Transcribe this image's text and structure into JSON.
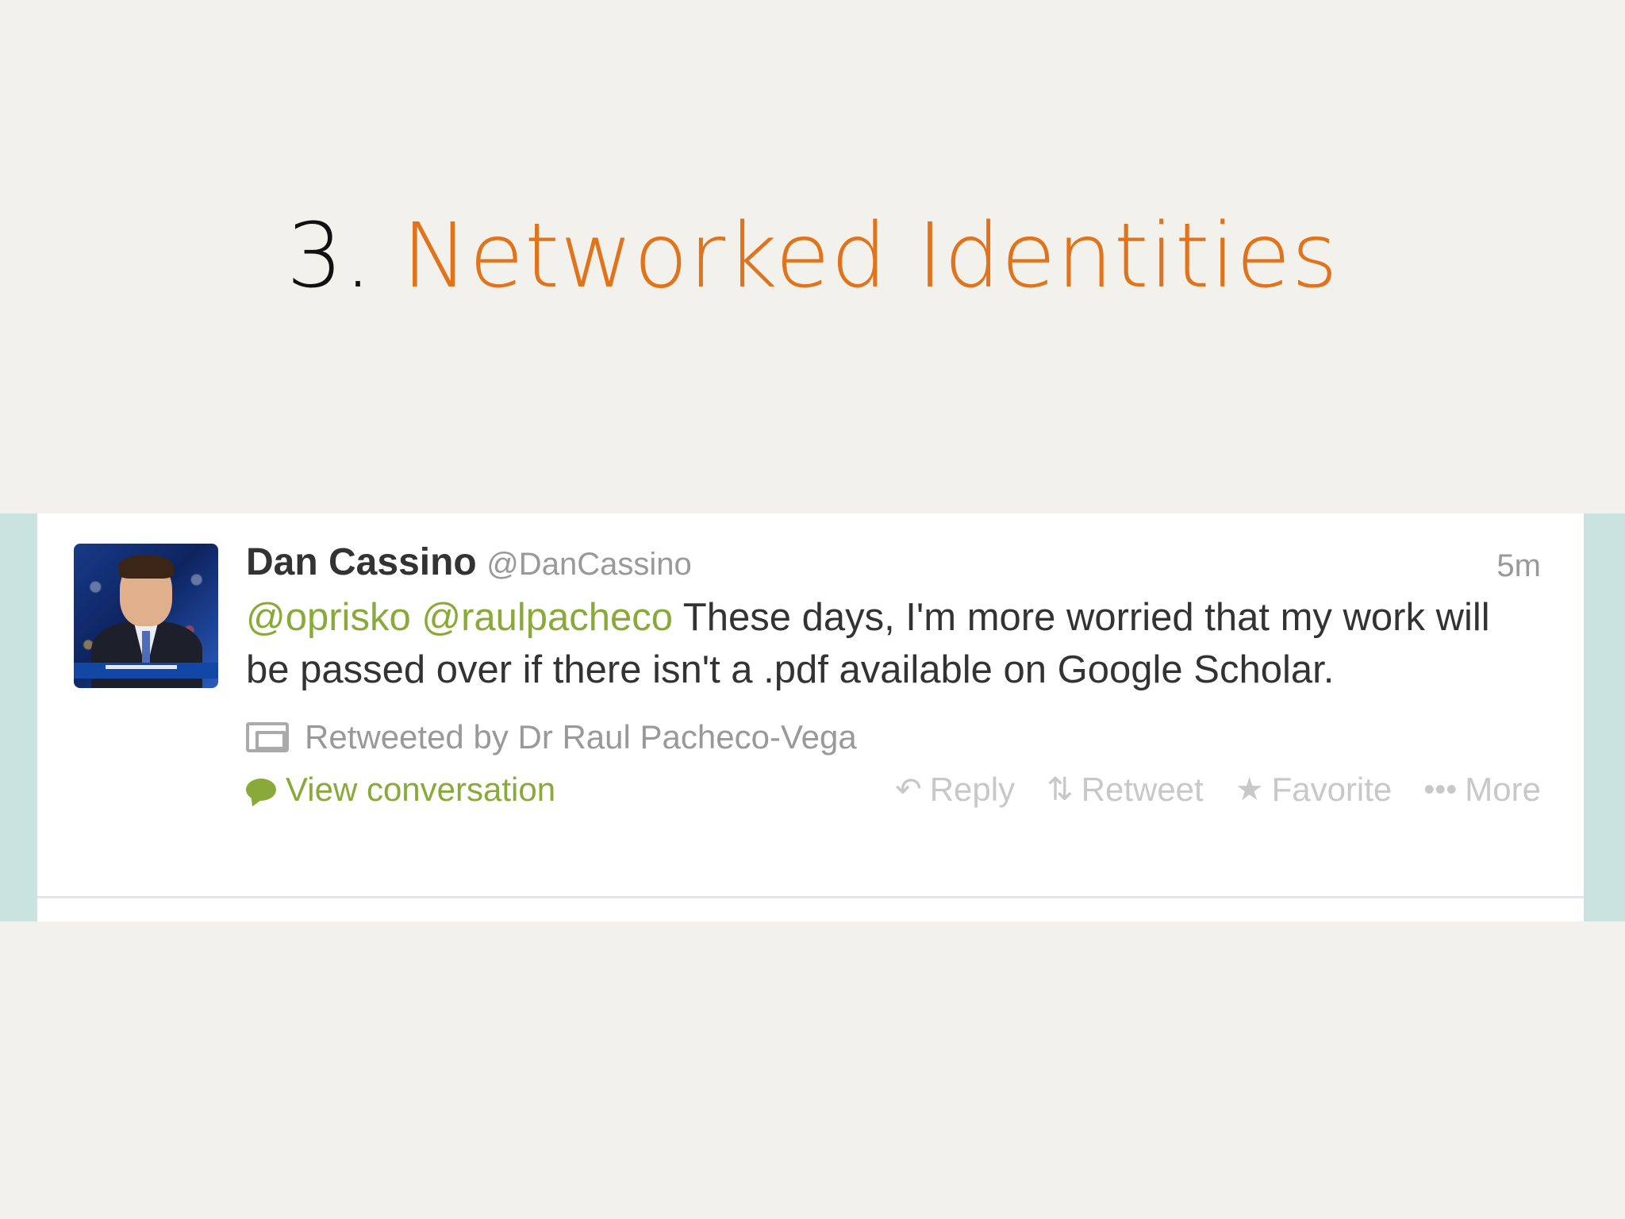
{
  "slide": {
    "title_number": "3.",
    "title_text": "Networked Identities",
    "title_accent_color": "#e0731b"
  },
  "tweet": {
    "author_name": "Dan Cassino",
    "author_handle": "@DanCassino",
    "timestamp": "5m",
    "mention_1": "@oprisko",
    "mention_2": "@raulpacheco",
    "text": "These days, I'm more worried that my work will be passed over if there isn't a .pdf available on Google Scholar.",
    "retweeted_by": "Retweeted by Dr Raul Pacheco-Vega",
    "view_conversation": "View conversation",
    "actions": {
      "reply": "Reply",
      "retweet": "Retweet",
      "favorite": "Favorite",
      "more": "More"
    },
    "icons": {
      "reply": "reply-icon",
      "retweet": "retweet-icon",
      "favorite": "star-icon",
      "more": "more-dots-icon",
      "conversation": "speech-bubble-icon",
      "retweeted": "retweeted-icon"
    },
    "colors": {
      "mention": "#89a938",
      "band": "#c9e3de"
    }
  }
}
